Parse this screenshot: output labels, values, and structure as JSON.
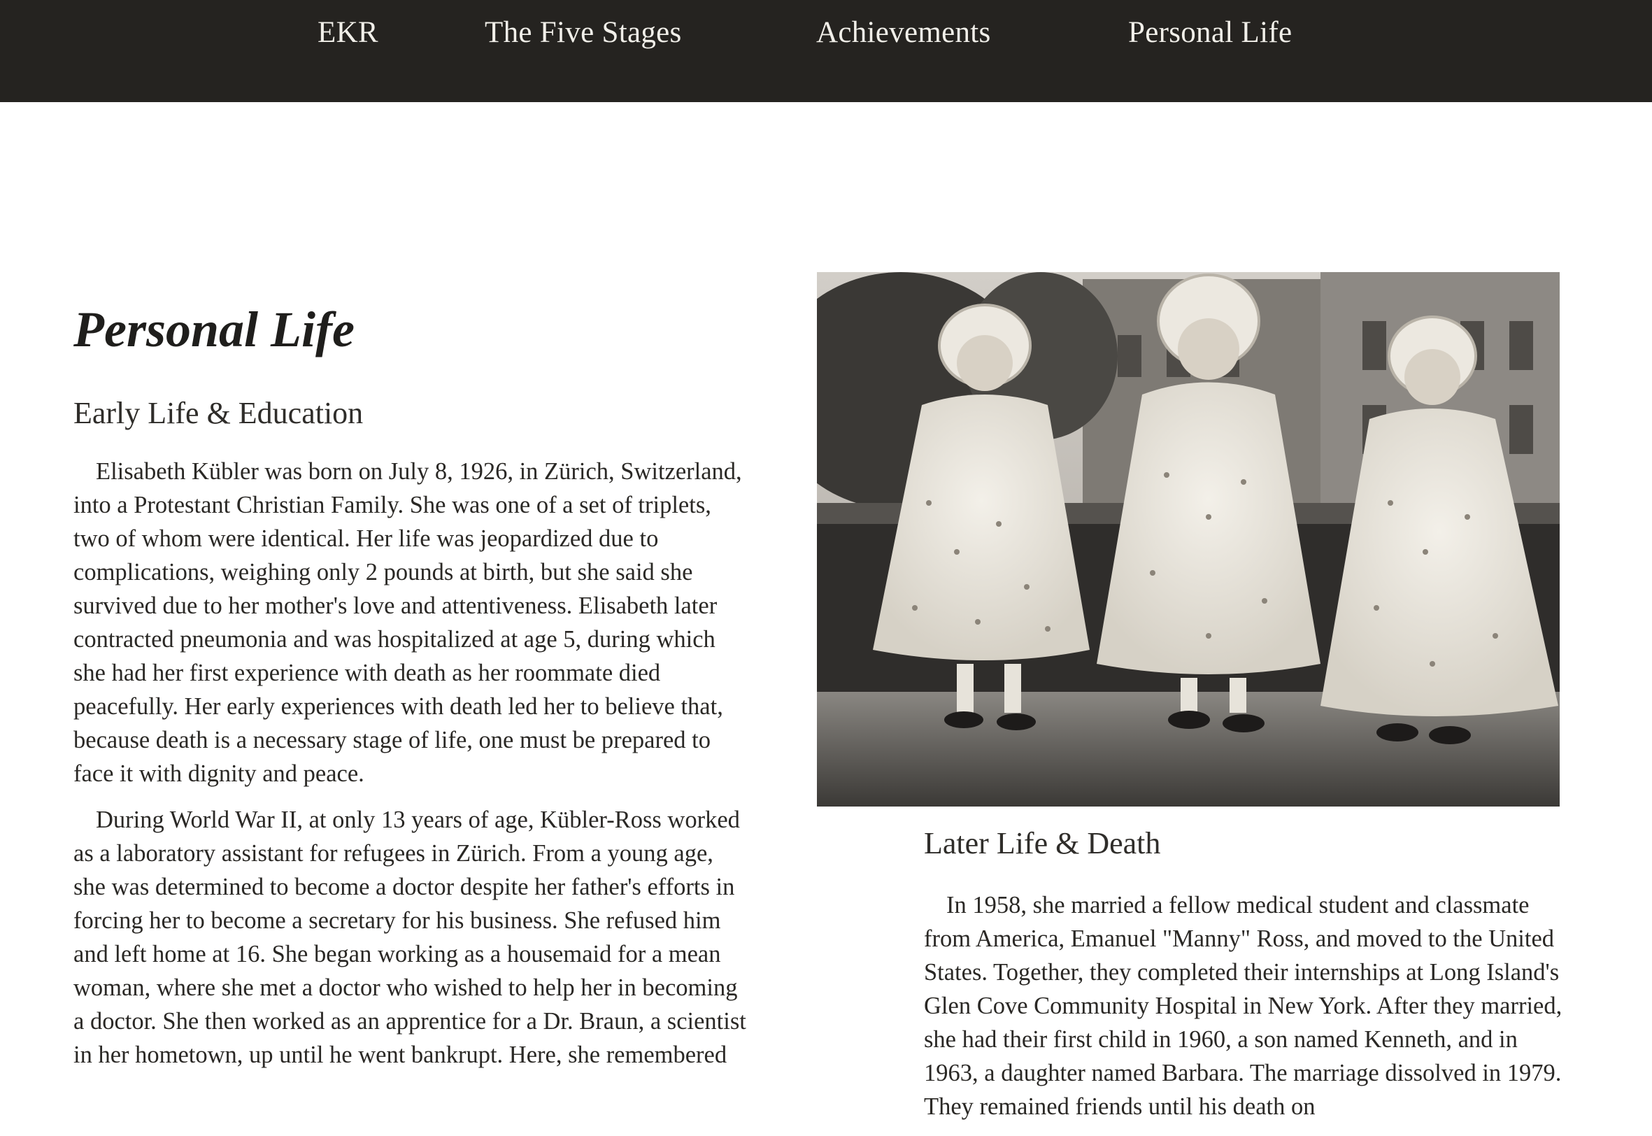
{
  "nav": {
    "items": [
      {
        "label": "EKR"
      },
      {
        "label": "The Five Stages"
      },
      {
        "label": "Achievements"
      },
      {
        "label": "Personal Life"
      }
    ]
  },
  "main": {
    "title": "Personal Life",
    "early": {
      "heading": "Early Life & Education",
      "paragraphs": [
        "Elisabeth Kübler was born on July 8, 1926, in Zürich, Switzerland, into a Protestant Christian Family. She was one of a set of triplets, two of whom were identical. Her life was jeopardized due to complications, weighing only 2 pounds at birth, but she said she survived due to her mother's love and attentiveness. Elisabeth later contracted pneumonia and was hospitalized at age 5, during which she had her first experience with death as her roommate died peacefully. Her early experiences with death led her to believe that, because death is a necessary stage of life, one must be prepared to face it with dignity and peace.",
        "During World War II, at only 13 years of age, Kübler-Ross worked as a laboratory assistant for refugees in Zürich. From a young age, she was determined to become a doctor despite her father's efforts in forcing her to become a secretary for his business. She refused him and left home at 16. She began working as a housemaid for a mean woman, where she met a doctor who wished to help her in becoming a doctor. She then worked as an apprentice for a Dr. Braun, a scientist in her hometown, up until he went bankrupt. Here, she remembered"
      ]
    },
    "later": {
      "heading": "Later Life & Death",
      "paragraphs": [
        "In 1958, she married a fellow medical student and classmate from America, Emanuel \"Manny\" Ross, and moved to the United States. Together, they completed their internships at Long Island's Glen Cove Community Hospital in New York. After they married, she had their first child in 1960, a son named Kenneth, and in 1963, a daughter named Barbara. The marriage dissolved in 1979. They remained friends until his death on"
      ]
    }
  },
  "colors": {
    "nav_bg": "#252320",
    "nav_text": "#f1efe9",
    "body_text": "#2a2825",
    "background": "#ffffff"
  }
}
